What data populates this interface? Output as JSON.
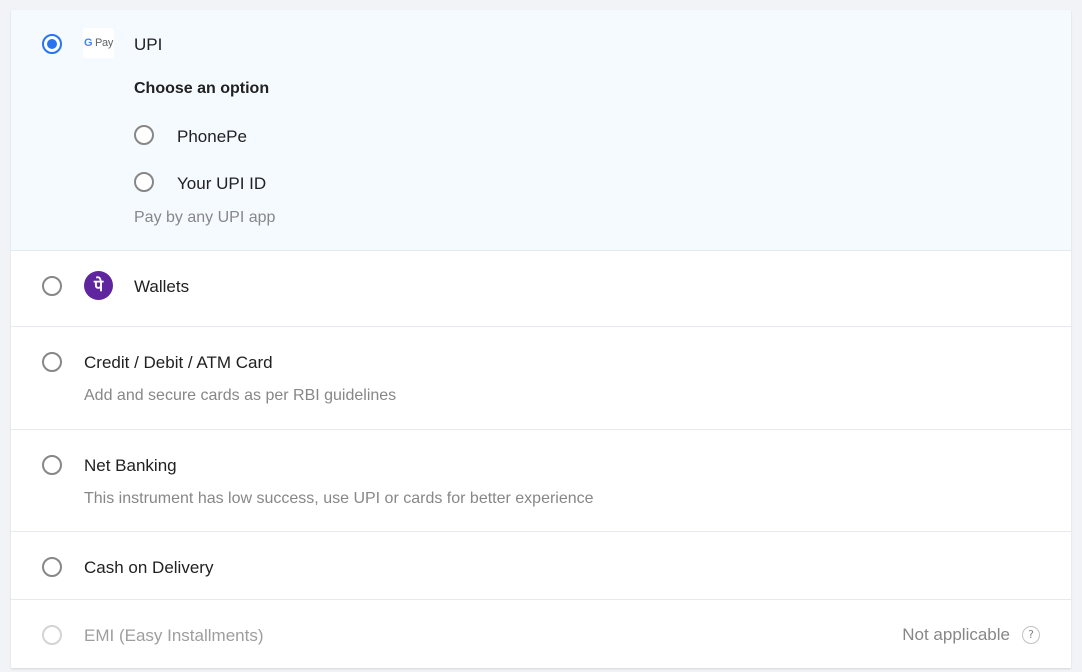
{
  "upi": {
    "label": "UPI",
    "logo_text": "Pay",
    "logo_g": "G",
    "choose_heading": "Choose an option",
    "options": [
      {
        "label": "PhonePe"
      },
      {
        "label": "Your UPI ID"
      }
    ],
    "note": "Pay by any UPI app"
  },
  "wallets": {
    "label": "Wallets",
    "logo_glyph": "पे"
  },
  "card": {
    "label": "Credit / Debit / ATM Card",
    "note": "Add and secure cards as per RBI guidelines"
  },
  "netbanking": {
    "label": "Net Banking",
    "note": "This instrument has low success, use UPI or cards for better experience"
  },
  "cod": {
    "label": "Cash on Delivery"
  },
  "emi": {
    "label": "EMI (Easy Installments)",
    "status": "Not applicable",
    "help_glyph": "?"
  },
  "colors": {
    "accent": "#2874f0",
    "selected_bg": "#f5faff",
    "phonepe_purple": "#5f259f"
  }
}
